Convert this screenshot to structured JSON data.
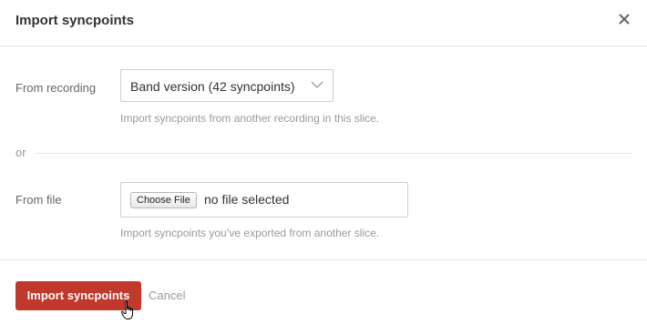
{
  "dialog": {
    "title": "Import syncpoints",
    "close_icon": "close-icon"
  },
  "recording": {
    "label": "From recording",
    "selected_value": "Band version (42 syncpoints)",
    "chevron_icon": "chevron-down-icon",
    "help": "Import syncpoints from another recording in this slice."
  },
  "separator": {
    "label": "or"
  },
  "file": {
    "label": "From file",
    "choose_label": "Choose File",
    "status": "no file selected",
    "help": "Import syncpoints you’ve exported from another slice."
  },
  "footer": {
    "import_label": "Import syncpoints",
    "cancel_label": "Cancel"
  },
  "colors": {
    "accent": "#c0392b",
    "text": "#333333",
    "muted": "#999999",
    "border": "#cccccc",
    "divider": "#e6e6e6"
  },
  "cursor": {
    "icon": "hand-pointer-icon"
  }
}
